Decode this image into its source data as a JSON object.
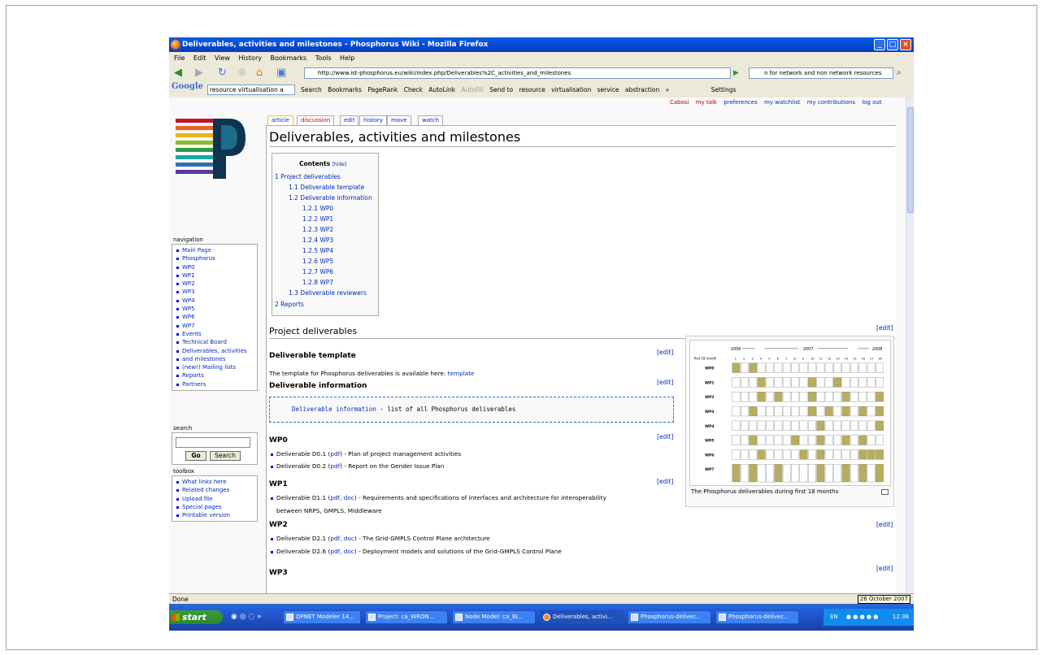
{
  "window": {
    "title": "Deliverables, activities and milestones - Phosphorus Wiki - Mozilla Firefox"
  },
  "menu": [
    "File",
    "Edit",
    "View",
    "History",
    "Bookmarks",
    "Tools",
    "Help"
  ],
  "nav": {
    "url": "http://www.ist-phosphorus.eu/wiki/index.php/Deliverables%2C_activities_and_milestones",
    "search_value": "n for network and non network resources"
  },
  "google_toolbar": {
    "logo": "Google",
    "input_value": "resource virtualisation a",
    "items": [
      "Search",
      "Bookmarks",
      "PageRank",
      "Check",
      "AutoLink",
      "AutoFill",
      "Send to",
      "resource",
      "virtualisation",
      "service",
      "abstraction",
      "»",
      "Settings"
    ]
  },
  "personal": [
    "Cabosi",
    "my talk",
    "preferences",
    "my watchlist",
    "my contributions",
    "log out"
  ],
  "tabs": [
    "article",
    "discussion",
    "edit",
    "history",
    "move",
    "watch"
  ],
  "page_title": "Deliverables, activities and milestones",
  "sidebar": {
    "navigation_title": "navigation",
    "navigation": [
      "Main Page",
      "Phosphorus",
      "WP0",
      "WP1",
      "WP2",
      "WP3",
      "WP4",
      "WP5",
      "WP6",
      "WP7",
      "Events",
      "Technical Board",
      "Deliverables, activities",
      "and milestones",
      "(new!) Mailing lists",
      "Reports",
      "Partners"
    ],
    "search_title": "search",
    "go_label": "Go",
    "search_label": "Search",
    "toolbox_title": "toolbox",
    "toolbox": [
      "What links here",
      "Related changes",
      "Upload file",
      "Special pages",
      "Printable version"
    ]
  },
  "toc": {
    "title": "Contents",
    "hide": "[hide]",
    "items": [
      "1 Project deliverables",
      "1.1 Deliverable template",
      "1.2 Deliverable information",
      "1.2.1 WP0",
      "1.2.2 WP1",
      "1.2.3 WP2",
      "1.2.4 WP3",
      "1.2.5 WP4",
      "1.2.6 WP5",
      "1.2.7 WP6",
      "1.2.8 WP7",
      "1.3 Deliverable reviewers",
      "2 Reports"
    ]
  },
  "content": {
    "edit": "[edit]",
    "h_project": "Project deliverables",
    "h_template": "Deliverable template",
    "template_text": "The template for Phosphorus deliverables is available here: ",
    "template_link": "template",
    "h_info": "Deliverable information",
    "pre_link": "Deliverable information",
    "pre_text": " - list of all Phosphorus deliverables",
    "wp0": "WP0",
    "wp0_items": [
      {
        "pre": "Deliverable D0.1 (",
        "link": "pdf",
        "post": ") - Plan of project management activities"
      },
      {
        "pre": "Deliverable D0.2 (",
        "link": "pdf",
        "post": ") - Report on the Gender Issue Plan"
      }
    ],
    "wp1": "WP1",
    "wp1_items": [
      {
        "pre": "Deliverable D1.1 (",
        "link": "pdf, doc",
        "post": ") - Requirements and specifications of interfaces and architecture for interoperability"
      }
    ],
    "wp1_cont": "between NRPS, GMPLS, Middleware",
    "wp2": "WP2",
    "wp2_items": [
      {
        "pre": "Deliverable D2.1 (",
        "link": "pdf, doc",
        "post": ") - The Grid-GMPLS Control Plane architecture"
      },
      {
        "pre": "Deliverable D2.6 (",
        "link": "pdf, doc",
        "post": ") - Deployment models and solutions of the Grid-GMPLS Control Plane"
      }
    ],
    "wp3": "WP3"
  },
  "thumb": {
    "caption": "The Phosphorus deliverables during first 18 months",
    "years": [
      "2006",
      "2007",
      "2008"
    ],
    "row_header": "first 18 month",
    "rows": [
      "WP0",
      "WP1",
      "WP2",
      "WP3",
      "WP4",
      "WP5",
      "WP6",
      "WP7"
    ]
  },
  "status": "Done",
  "tooltip_date": "26 October 2007",
  "taskbar": {
    "start": "start",
    "buttons": [
      "OPNET Modeler 14...",
      "Project: ca_WRON...",
      "Node Model: ca_W...",
      "Deliverables, activi...",
      "Phosphorus-deliver...",
      "Phosphorus-deliver..."
    ],
    "lang": "EN",
    "time": "12:38"
  }
}
